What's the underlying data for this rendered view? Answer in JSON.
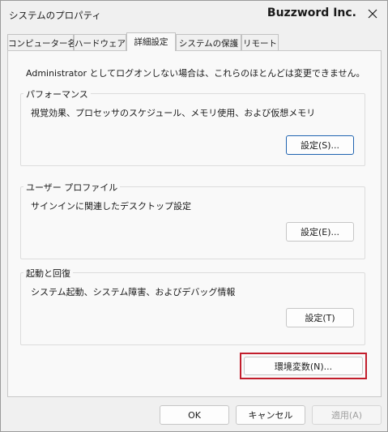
{
  "window": {
    "title": "システムのプロパティ",
    "brand": "Buzzword Inc.",
    "close_glyph": "✕"
  },
  "tabs": [
    {
      "label": "コンピューター名",
      "active": false
    },
    {
      "label": "ハードウェア",
      "active": false
    },
    {
      "label": "詳細設定",
      "active": true
    },
    {
      "label": "システムの保護",
      "active": false
    },
    {
      "label": "リモート",
      "active": false
    }
  ],
  "advanced": {
    "notice": "Administrator としてログオンしない場合は、これらのほとんどは変更できません。",
    "performance": {
      "label": "パフォーマンス",
      "description": "視覚効果、プロセッサのスケジュール、メモリ使用、および仮想メモリ",
      "button": "設定(S)..."
    },
    "user_profile": {
      "label": "ユーザー プロファイル",
      "description": "サインインに関連したデスクトップ設定",
      "button": "設定(E)..."
    },
    "startup_recovery": {
      "label": "起動と回復",
      "description": "システム起動、システム障害、およびデバッグ情報",
      "button": "設定(T)"
    },
    "env_button": "環境変数(N)..."
  },
  "footer": {
    "ok": "OK",
    "cancel": "キャンセル",
    "apply": "適用(A)"
  },
  "colors": {
    "highlight": "#c21e2c",
    "focus": "#1f63b0"
  }
}
